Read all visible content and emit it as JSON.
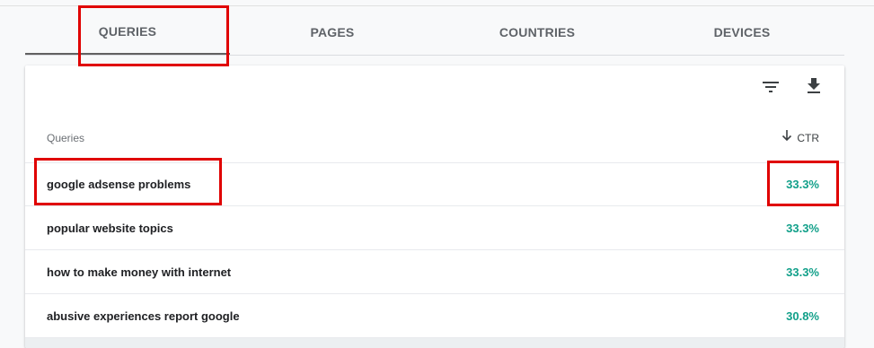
{
  "tabs": [
    {
      "label": "QUERIES",
      "active": true
    },
    {
      "label": "PAGES",
      "active": false
    },
    {
      "label": "COUNTRIES",
      "active": false
    },
    {
      "label": "DEVICES",
      "active": false
    }
  ],
  "toolbar": {
    "filter_icon": "filter-icon",
    "download_icon": "download-icon"
  },
  "table": {
    "query_column": "Queries",
    "ctr_column": "CTR",
    "sort_icon": "arrow-down-icon",
    "rows": [
      {
        "query": "google adsense problems",
        "ctr": "33.3%"
      },
      {
        "query": "popular website topics",
        "ctr": "33.3%"
      },
      {
        "query": "how to make money with internet",
        "ctr": "33.3%"
      },
      {
        "query": "abusive experiences report google",
        "ctr": "30.8%"
      }
    ]
  },
  "colors": {
    "ctr_value": "#12a08a",
    "highlight_box": "#e00000",
    "active_tab_underline": "#616161"
  }
}
